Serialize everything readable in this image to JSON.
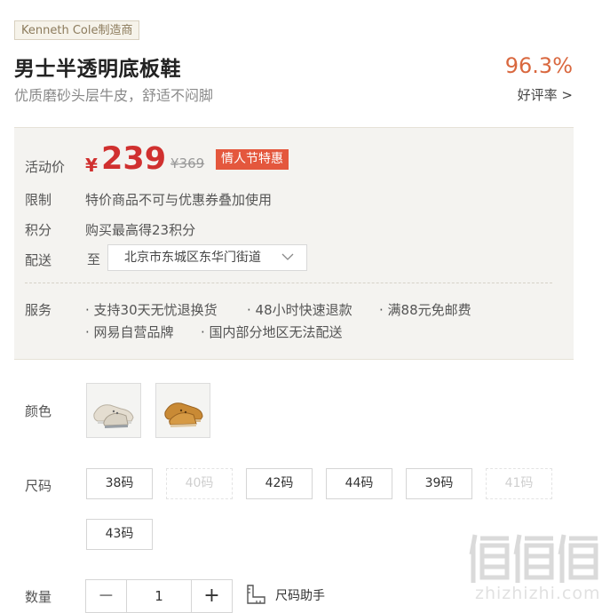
{
  "product": {
    "brand_tag": "Kenneth Cole制造商",
    "title": "男士半透明底板鞋",
    "subtitle": "优质磨砂头层牛皮，舒适不闷脚",
    "rating_value": "96.3%",
    "rating_link": "好评率 >"
  },
  "price_panel": {
    "price_label": "活动价",
    "currency": "¥",
    "price": "239",
    "original_price": "¥369",
    "promo_tag": "情人节特惠",
    "limit_label": "限制",
    "limit_text": "特价商品不可与优惠券叠加使用",
    "points_label": "积分",
    "points_text": "购买最高得23积分",
    "delivery_label": "配送",
    "delivery_prefix": "至",
    "delivery_address": "北京市东城区东华门街道",
    "service_label": "服务",
    "services": [
      "· 支持30天无忧退换货",
      "· 48小时快速退款",
      "· 满88元免邮费",
      "· 网易自营品牌",
      "· 国内部分地区无法配送"
    ]
  },
  "options": {
    "color_label": "颜色",
    "colors": [
      "grey-beige",
      "tan-brown"
    ],
    "size_label": "尺码",
    "sizes": [
      {
        "label": "38码",
        "available": true
      },
      {
        "label": "40码",
        "available": false
      },
      {
        "label": "42码",
        "available": true
      },
      {
        "label": "44码",
        "available": true
      },
      {
        "label": "39码",
        "available": true
      },
      {
        "label": "41码",
        "available": false
      },
      {
        "label": "43码",
        "available": true
      }
    ],
    "quantity_label": "数量",
    "quantity": "1",
    "minus_symbol": "−",
    "plus_symbol": "+",
    "size_helper": "尺码助手"
  },
  "watermark": {
    "text": "zhizhizhi.com"
  },
  "colors": {
    "accent_red": "#d0302f",
    "rating_orange": "#d9683f",
    "promo_bg": "#e4573d",
    "panel_bg": "#f4f3f0"
  }
}
